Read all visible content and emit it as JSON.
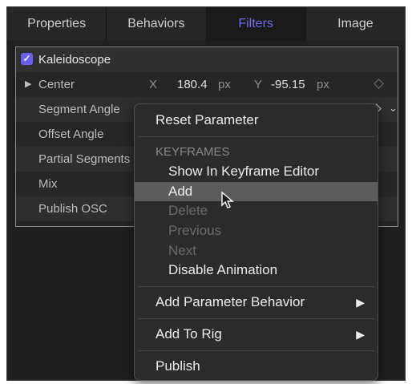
{
  "tabs": [
    {
      "label": "Properties"
    },
    {
      "label": "Behaviors"
    },
    {
      "label": "Filters"
    },
    {
      "label": "Image"
    }
  ],
  "filter": {
    "name": "Kaleidoscope",
    "enabled": true
  },
  "params": [
    {
      "label": "Center",
      "x_label": "X",
      "x_value": "180.4",
      "x_unit": "px",
      "y_label": "Y",
      "y_value": "-95.15",
      "y_unit": "px"
    },
    {
      "label": "Segment Angle"
    },
    {
      "label": "Offset Angle"
    },
    {
      "label": "Partial Segments"
    },
    {
      "label": "Mix"
    },
    {
      "label": "Publish OSC"
    }
  ],
  "menu": {
    "reset": "Reset Parameter",
    "keyframes_header": "KEYFRAMES",
    "show_in_editor": "Show In Keyframe Editor",
    "add": "Add",
    "delete": "Delete",
    "previous": "Previous",
    "next": "Next",
    "disable_animation": "Disable Animation",
    "add_param_behavior": "Add Parameter Behavior",
    "add_to_rig": "Add To Rig",
    "publish": "Publish"
  },
  "colors": {
    "accent": "#6e6cf0",
    "checkbox": "#6a5ff2",
    "highlight": "#5c5c5c"
  }
}
